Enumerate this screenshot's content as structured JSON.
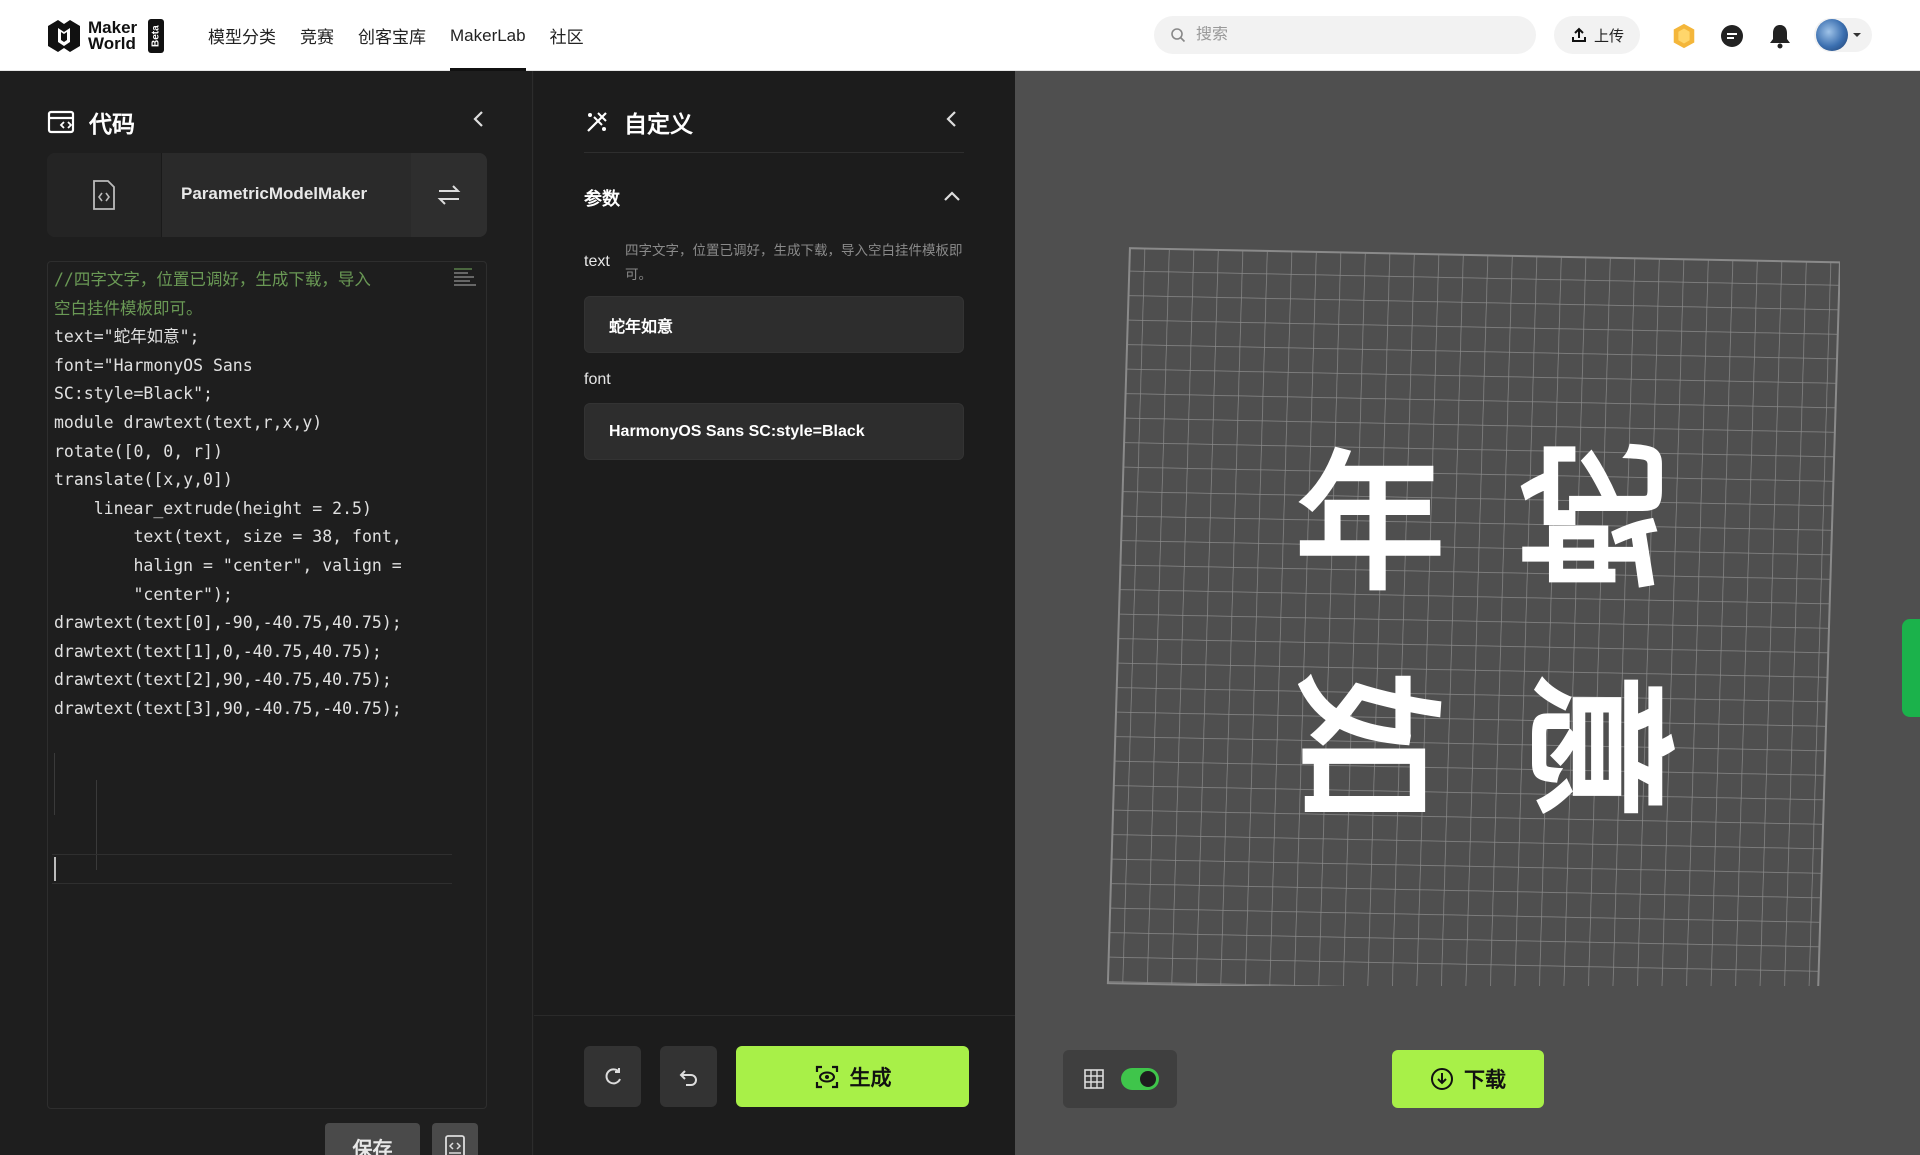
{
  "header": {
    "logo_line1": "Maker",
    "logo_line2": "World",
    "beta": "Beta",
    "nav": [
      "模型分类",
      "竞赛",
      "创客宝库",
      "MakerLab",
      "社区"
    ],
    "nav_active": "MakerLab",
    "search_placeholder": "搜索",
    "upload_label": "上传",
    "icons": [
      "coin-icon",
      "message-icon",
      "bell-icon",
      "avatar",
      "chevron-down-icon"
    ]
  },
  "code_panel": {
    "title": "代码",
    "file_name": "ParametricModelMaker",
    "save_label": "保存",
    "lines": [
      "//四字文字，位置已调好，生成下载，导入",
      "空白挂件模板即可。",
      "text=\"蛇年如意\";",
      "font=\"HarmonyOS Sans",
      "SC:style=Black\";",
      "",
      "module drawtext(text,r,x,y)",
      "rotate([0, 0, r])",
      "translate([x,y,0])",
      "    linear_extrude(height = 2.5)",
      "        text(text, size = 38, font,",
      "        halign = \"center\", valign =",
      "        \"center\");",
      "",
      "drawtext(text[0],-90,-40.75,40.75);",
      "drawtext(text[1],0,-40.75,40.75);",
      "drawtext(text[2],90,-40.75,40.75);",
      "drawtext(text[3],90,-40.75,-40.75);"
    ]
  },
  "custom_panel": {
    "title": "自定义",
    "section": "参数",
    "params": [
      {
        "label": "text",
        "desc": "四字文字，位置已调好，生成下载，导入空白挂件模板即可。",
        "value": "蛇年如意"
      },
      {
        "label": "font",
        "desc": "",
        "value": "HarmonyOS Sans SC:style=Black"
      }
    ],
    "generate_label": "生成"
  },
  "viewport": {
    "download_label": "下载",
    "grid_toggle": true,
    "plate_chars": [
      "年",
      "蛇",
      "如",
      "意"
    ],
    "accent": "#a8f048"
  }
}
